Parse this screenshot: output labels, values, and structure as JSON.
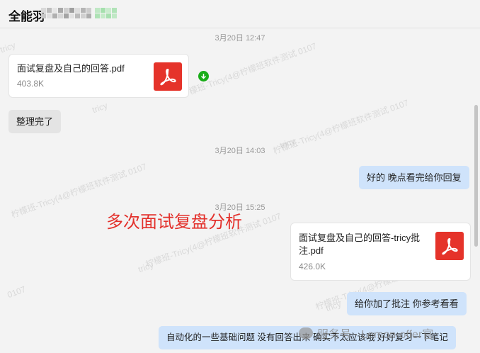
{
  "header": {
    "title": "全能羽"
  },
  "messages": {
    "ts1": "3月20日 12:47",
    "file1": {
      "name": "面试复盘及自己的回答.pdf",
      "size": "403.8K"
    },
    "msg1": "整理完了",
    "ts2": "3月20日 14:03",
    "msg2": "好的 晚点看完给你回复",
    "ts3": "3月20日 15:25",
    "file2": {
      "name_line1": "面试复盘及自己的回答-tricy批",
      "name_line2": "注.pdf",
      "size": "426.0K"
    },
    "msg3": "给你加了批注 你参考看看",
    "msg4": "自动化的一些基础问题 没有回答出来 确实不太应该哦 好好复习一下笔记"
  },
  "annotation": "多次面试复盘分析",
  "watermarks": {
    "w1": "柠檬班-Tricy(4@柠檬班软件测试 0107",
    "w2": "tricy",
    "w3": "0107"
  },
  "promo": {
    "text": "服务号 · Lemon-offer官"
  },
  "colors": {
    "accent_red": "#e5332a",
    "bubble_out": "#cfe3fb",
    "bubble_in": "#e4e4e4",
    "download_green": "#1aad19"
  },
  "icons": {
    "pdf": "pdf-icon",
    "download": "download-icon",
    "promo": "wechat-icon"
  }
}
